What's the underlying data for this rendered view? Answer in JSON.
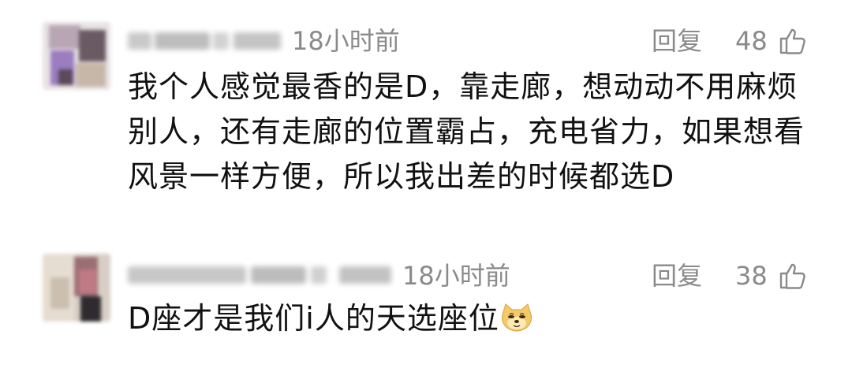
{
  "comments": [
    {
      "time": "18小时前",
      "reply_label": "回复",
      "likes": "48",
      "text": "我个人感觉最香的是D，靠走廊，想动动不用麻烦别人，还有走廊的位置霸占，充电省力，如果想看风景一样方便，所以我出差的时候都选D"
    },
    {
      "time": "18小时前",
      "reply_label": "回复",
      "likes": "38",
      "text": "D座才是我们i人的天选座位",
      "emoji": "doge-emoji"
    }
  ],
  "icons": {
    "like": "thumbs-up-icon"
  },
  "colors": {
    "meta_text": "#8a8a8a",
    "body_text": "#111111"
  }
}
